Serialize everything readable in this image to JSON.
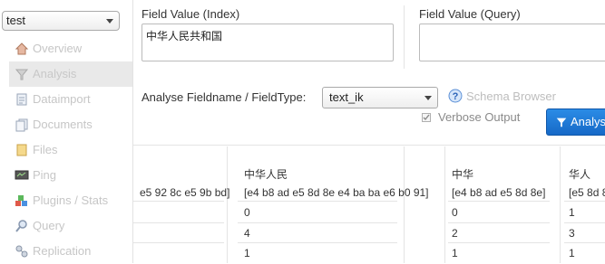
{
  "sidebar": {
    "core": "test",
    "items": [
      {
        "label": "Overview",
        "icon": "house-icon"
      },
      {
        "label": "Analysis",
        "icon": "funnel-icon"
      },
      {
        "label": "Dataimport",
        "icon": "document-icon"
      },
      {
        "label": "Documents",
        "icon": "documents-icon"
      },
      {
        "label": "Files",
        "icon": "folder-icon"
      },
      {
        "label": "Ping",
        "icon": "monitor-icon"
      },
      {
        "label": "Plugins / Stats",
        "icon": "plugins-icon"
      },
      {
        "label": "Query",
        "icon": "magnifier-icon"
      },
      {
        "label": "Replication",
        "icon": "replication-icon"
      }
    ]
  },
  "main": {
    "index_label": "Field Value (Index)",
    "index_value": "中华人民共和国",
    "query_label": "Field Value (Query)",
    "query_value": "",
    "fieldtype_label": "Analyse Fieldname / FieldType:",
    "fieldtype_value": "text_ik",
    "schema_browser": "Schema Browser",
    "verbose_label": "Verbose Output",
    "analyse_button": "Analyse Values"
  },
  "results": {
    "left_partial_bytes": "e5 92 8c e5 9b bd]",
    "columns": [
      {
        "term": "中华人民",
        "bytes": "[e4 b8 ad e5 8d 8e e4 ba ba e6 b0 91]",
        "rows": [
          "0",
          "4",
          "1"
        ]
      },
      {
        "term": "中华",
        "bytes": "[e4 b8 ad e5 8d 8e]",
        "rows": [
          "0",
          "2",
          "1"
        ]
      },
      {
        "term": "华人",
        "bytes": "[e5 8d 8",
        "rows": [
          "1",
          "3",
          "1"
        ]
      }
    ]
  },
  "colors": {
    "accent": "#1a73d1",
    "sidebar_active_bg": "#e9e9e9"
  }
}
